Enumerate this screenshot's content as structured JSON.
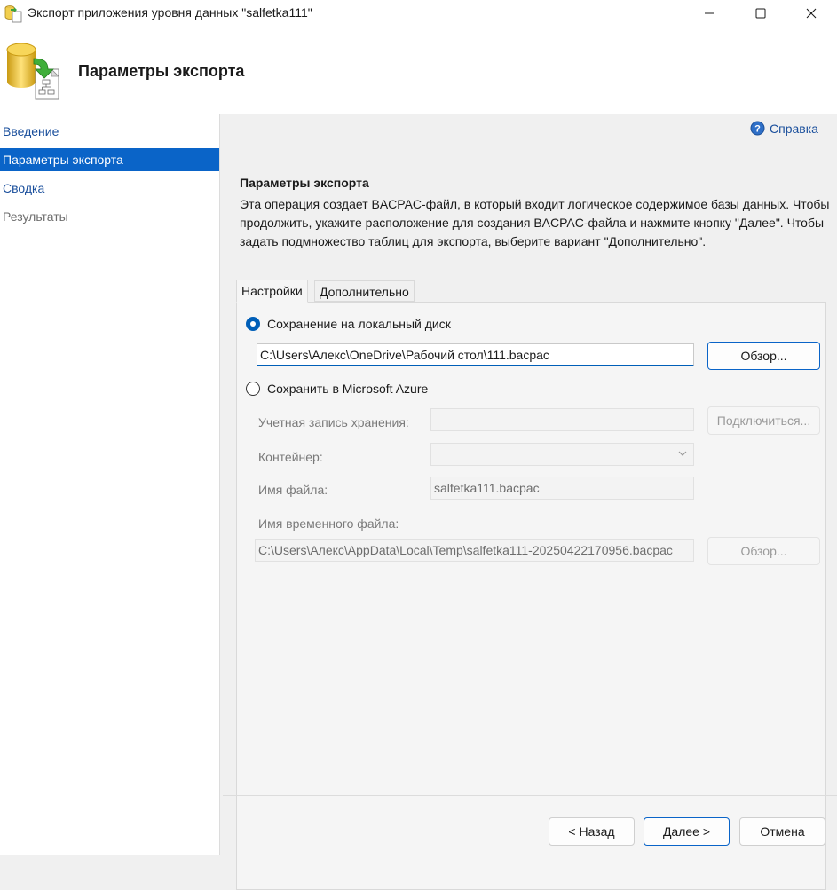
{
  "window": {
    "title": "Экспорт приложения уровня данных \"salfetka111\"",
    "icon": "dacpac-app-icon",
    "controls": [
      "minimize-icon",
      "maximize-icon",
      "close-icon"
    ]
  },
  "header": {
    "title": "Параметры экспорта",
    "icon": "database-export-icon"
  },
  "sidebar": {
    "items": [
      {
        "label": "Введение",
        "state": "link"
      },
      {
        "label": "Параметры экспорта",
        "state": "selected"
      },
      {
        "label": "Сводка",
        "state": "link"
      },
      {
        "label": "Результаты",
        "state": "disabled"
      }
    ]
  },
  "help": {
    "label": "Справка",
    "icon": "help-icon"
  },
  "section": {
    "title": "Параметры экспорта",
    "description": "Эта операция создает BACPAC-файл, в который входит логическое содержимое базы данных. Чтобы продолжить, укажите расположение для создания BACPAC-файла и нажмите кнопку \"Далее\". Чтобы задать подмножество таблиц для экспорта, выберите вариант \"Дополнительно\"."
  },
  "tabs": [
    {
      "label": "Настройки",
      "active": true
    },
    {
      "label": "Дополнительно",
      "active": false
    }
  ],
  "local": {
    "radio_label": "Сохранение на локальный диск",
    "selected": true,
    "path": "C:\\Users\\Алекс\\OneDrive\\Рабочий стол\\111.bacpac",
    "browse_label": "Обзор..."
  },
  "azure": {
    "radio_label": "Сохранить в Microsoft Azure",
    "selected": false,
    "storage_label": "Учетная запись хранения:",
    "storage_value": "",
    "connect_label": "Подключиться...",
    "container_label": "Контейнер:",
    "container_value": "",
    "filename_label": "Имя файла:",
    "filename_value": "salfetka111.bacpac",
    "tempfile_label": "Имя временного файла:",
    "tempfile_value": "C:\\Users\\Алекс\\AppData\\Local\\Temp\\salfetka111-20250422170956.bacpac",
    "browse_label": "Обзор..."
  },
  "footer": {
    "back_label": "< Назад",
    "next_label": "Далее >",
    "cancel_label": "Отмена"
  },
  "colors": {
    "accent": "#0a64c8",
    "link": "#1a4f9c",
    "disabled_text": "#7a7a7a"
  }
}
